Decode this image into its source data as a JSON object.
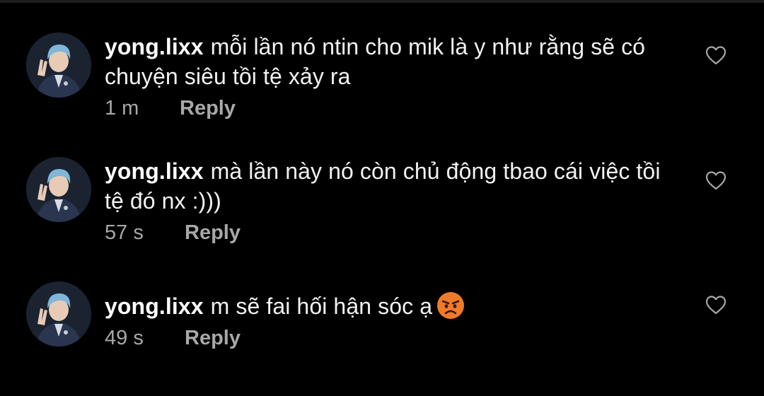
{
  "comments": [
    {
      "username": "yong.lixx",
      "text": "mỗi lần nó ntin cho mik là y như rằng sẽ có chuyện siêu tồi tệ xảy ra",
      "time": "1 m",
      "reply_label": "Reply",
      "avatar_icon": "avatar-photo",
      "like_icon": "heart-outline-icon"
    },
    {
      "username": "yong.lixx",
      "text": "mà lần này nó còn chủ động tbao cái việc tồi tệ đó nx :)))",
      "time": "57 s",
      "reply_label": "Reply",
      "avatar_icon": "avatar-photo",
      "like_icon": "heart-outline-icon"
    },
    {
      "username": "yong.lixx",
      "text": "m sẽ fai hối hận sóc ạ",
      "emoji": "angry-face-emoji",
      "time": "49 s",
      "reply_label": "Reply",
      "avatar_icon": "avatar-photo",
      "like_icon": "heart-outline-icon"
    }
  ],
  "colors": {
    "background": "#000000",
    "primary_text": "#f2f2f2",
    "secondary_text": "#a8a8a8",
    "avatar_hair": "#7fb6d9",
    "emoji_face": "#f07a2c"
  }
}
